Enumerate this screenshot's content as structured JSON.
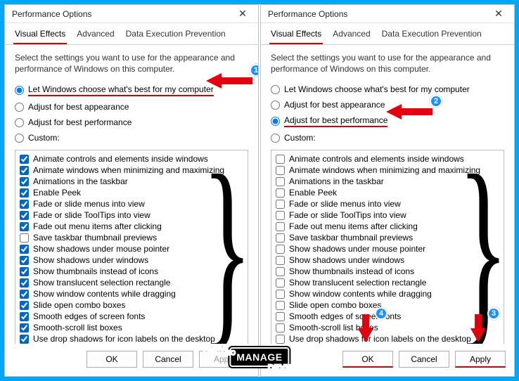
{
  "windows": {
    "title": "Performance Options",
    "tabs": [
      "Visual Effects",
      "Advanced",
      "Data Execution Prevention"
    ],
    "active_tab": 0,
    "instruction": "Select the settings you want to use for the appearance and performance of Windows on this computer.",
    "radios": {
      "r0": "Let Windows choose what's best for my computer",
      "r1": "Adjust for best appearance",
      "r2": "Adjust for best performance",
      "r3": "Custom:"
    },
    "effects": [
      "Animate controls and elements inside windows",
      "Animate windows when minimizing and maximizing",
      "Animations in the taskbar",
      "Enable Peek",
      "Fade or slide menus into view",
      "Fade or slide ToolTips into view",
      "Fade out menu items after clicking",
      "Save taskbar thumbnail previews",
      "Show shadows under mouse pointer",
      "Show shadows under windows",
      "Show thumbnails instead of icons",
      "Show translucent selection rectangle",
      "Show window contents while dragging",
      "Slide open combo boxes",
      "Smooth edges of screen fonts",
      "Smooth-scroll list boxes",
      "Use drop shadows for icon labels on the desktop"
    ],
    "buttons": {
      "ok": "OK",
      "cancel": "Cancel",
      "apply": "Apply"
    }
  },
  "left": {
    "selected_radio": 0,
    "checked": [
      true,
      true,
      true,
      true,
      true,
      true,
      true,
      false,
      true,
      true,
      true,
      true,
      true,
      true,
      true,
      true,
      true
    ],
    "apply_enabled": false
  },
  "right": {
    "selected_radio": 2,
    "checked": [
      false,
      false,
      false,
      false,
      false,
      false,
      false,
      false,
      false,
      false,
      false,
      false,
      false,
      false,
      false,
      false,
      false
    ],
    "apply_enabled": true
  },
  "annotations": {
    "badges": {
      "b1": "1",
      "b2": "2",
      "b3": "3",
      "b4": "4"
    }
  },
  "watermark": {
    "how": "HOW",
    "to": "TO",
    "manage": "MANAGE",
    "devices": "DEVICES"
  }
}
